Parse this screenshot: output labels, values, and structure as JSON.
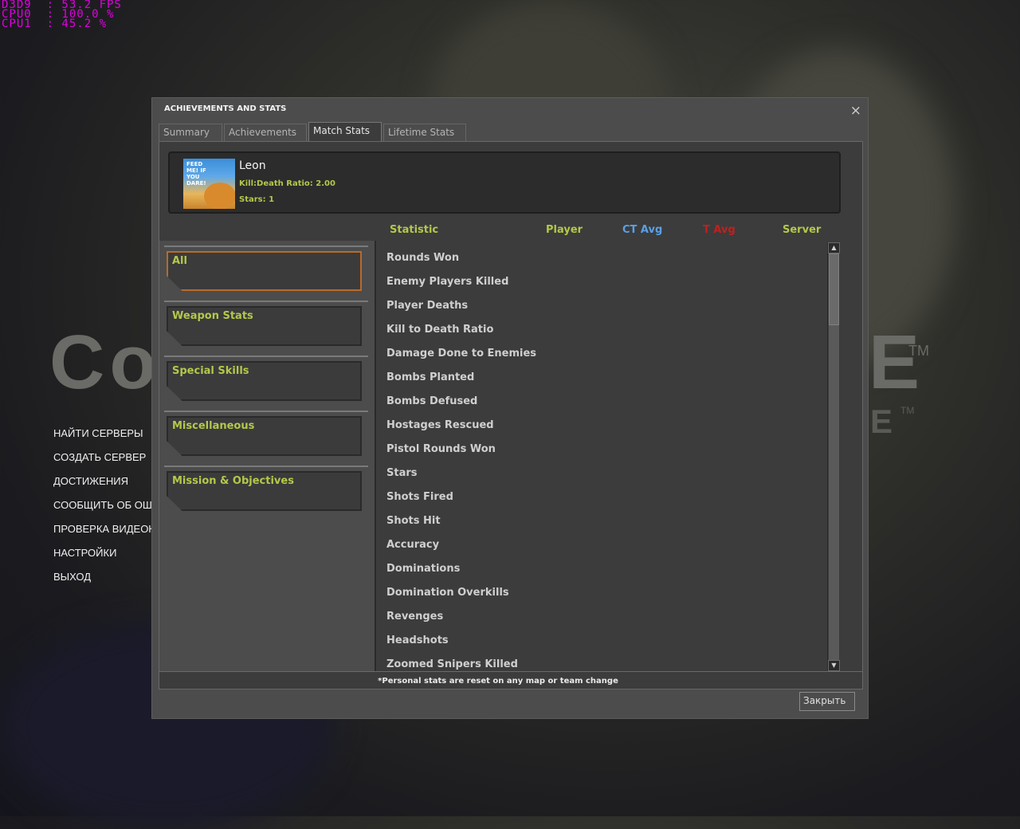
{
  "perf_overlay": {
    "lines": [
      "D3D9  : 53.2 FPS",
      "CPU0  : 100.0 %",
      "CPU1  : 45.2 %"
    ]
  },
  "main_menu": {
    "items": [
      "НАЙТИ СЕРВЕРЫ",
      "СОЗДАТЬ СЕРВЕР",
      "ДОСТИЖЕНИЯ",
      "СООБЩИТЬ ОБ ОШИБКЕ",
      "ПРОВЕРКА ВИДЕОКАРТЫ",
      "НАСТРОЙКИ",
      "ВЫХОД"
    ]
  },
  "background_logo": {
    "left_text": "Co",
    "right_text": "E",
    "tm": "TM",
    "small_text": "E"
  },
  "dialog": {
    "title": "ACHIEVEMENTS AND STATS",
    "close_icon": "×",
    "tabs": [
      {
        "label": "Summary",
        "active": false
      },
      {
        "label": "Achievements",
        "active": false
      },
      {
        "label": "Match Stats",
        "active": true
      },
      {
        "label": "Lifetime Stats",
        "active": false
      }
    ],
    "player": {
      "avatar_text": "FEED ME! IF YOU DARE!",
      "name": "Leon",
      "kd": "Kill:Death Ratio: 2.00",
      "stars": "Stars: 1"
    },
    "columns": [
      {
        "label": "Statistic",
        "color": "#b4c84a"
      },
      {
        "label": "Player",
        "color": "#b4c84a"
      },
      {
        "label": "CT Avg",
        "color": "#5aa0e6"
      },
      {
        "label": "T Avg",
        "color": "#c02020"
      },
      {
        "label": "Server",
        "color": "#b4c84a"
      }
    ],
    "categories": [
      {
        "label": "All",
        "active": true
      },
      {
        "label": "Weapon Stats",
        "active": false
      },
      {
        "label": "Special Skills",
        "active": false
      },
      {
        "label": "Miscellaneous",
        "active": false
      },
      {
        "label": "Mission & Objectives",
        "active": false
      }
    ],
    "stats": [
      "Rounds Won",
      "Enemy Players Killed",
      "Player Deaths",
      "Kill to Death Ratio",
      "Damage Done to Enemies",
      "Bombs Planted",
      "Bombs Defused",
      "Hostages Rescued",
      "Pistol Rounds Won",
      "Stars",
      "Shots Fired",
      "Shots Hit",
      "Accuracy",
      "Dominations",
      "Domination Overkills",
      "Revenges",
      "Headshots",
      "Zoomed Snipers Killed"
    ],
    "footnote": "*Personal stats are reset on any map or team change",
    "close_button": "Закрыть",
    "scroll_up_icon": "▲",
    "scroll_down_icon": "▼"
  },
  "colors": {
    "accent_green": "#b4c84a",
    "active_orange": "#b86a2a",
    "perf_magenta": "#e000e0"
  }
}
